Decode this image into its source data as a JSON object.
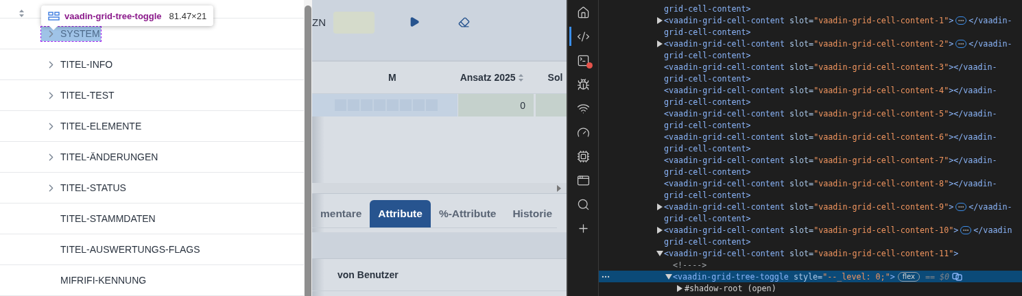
{
  "grid": {
    "rows": [
      {
        "name": "SYSTEM",
        "expandable": true,
        "highlighted": true
      },
      {
        "name": "TITEL-INFO",
        "expandable": true,
        "highlighted": false
      },
      {
        "name": "TITEL-TEST",
        "expandable": true,
        "highlighted": false
      },
      {
        "name": "TITEL-ELEMENTE",
        "expandable": true,
        "highlighted": false
      },
      {
        "name": "TITEL-ÄNDERUNGEN",
        "expandable": true,
        "highlighted": false
      },
      {
        "name": "TITEL-STATUS",
        "expandable": true,
        "highlighted": false
      },
      {
        "name": "TITEL-STAMMDATEN",
        "expandable": false,
        "highlighted": false
      },
      {
        "name": "TITEL-AUSWERTUNGS-FLAGS",
        "expandable": false,
        "highlighted": false
      },
      {
        "name": "MIFRIFI-KENNUNG",
        "expandable": false,
        "highlighted": false
      }
    ]
  },
  "inspector_tooltip": {
    "tag": "vaadin-grid-tree-toggle",
    "size": "81.47×21"
  },
  "app": {
    "filter_label": "ZN",
    "table": {
      "columns": [
        "M",
        "Ansatz 2025",
        "Sol"
      ],
      "row": [
        "0"
      ]
    },
    "tabs": [
      {
        "label": "mentare",
        "selected": false
      },
      {
        "label": "Attribute",
        "selected": true
      },
      {
        "label": "%-Attribute",
        "selected": false
      },
      {
        "label": "Historie",
        "selected": false
      }
    ],
    "detail": {
      "column": "von Benutzer"
    }
  },
  "devtools": {
    "activity": [
      {
        "selected": false,
        "alert": false
      },
      {
        "selected": true,
        "alert": false
      },
      {
        "selected": false,
        "alert": true
      },
      {
        "selected": false,
        "alert": false
      },
      {
        "selected": false,
        "alert": false
      },
      {
        "selected": false,
        "alert": false
      },
      {
        "selected": false,
        "alert": false
      },
      {
        "selected": false,
        "alert": false
      },
      {
        "selected": false,
        "alert": false
      },
      {
        "selected": false,
        "alert": false
      }
    ],
    "nodes": [
      {
        "kind": "tail",
        "selected": false,
        "text": "grid-cell-content>"
      },
      {
        "kind": "element",
        "has_children": true,
        "expanded": false,
        "selected": false,
        "tag": "<vaadin-grid-cell-content",
        "attr": " slot=",
        "value": "\"vaadin-grid-cell-content-1\"",
        "close": ">",
        "ellipsis": true,
        "end": "</vaadin-",
        "wrap": "grid-cell-content>"
      },
      {
        "kind": "element",
        "has_children": true,
        "expanded": false,
        "selected": false,
        "tag": "<vaadin-grid-cell-content",
        "attr": " slot=",
        "value": "\"vaadin-grid-cell-content-2\"",
        "close": ">",
        "ellipsis": true,
        "end": "</vaadin-",
        "wrap": "grid-cell-content>"
      },
      {
        "kind": "element",
        "has_children": false,
        "selected": false,
        "tag": "<vaadin-grid-cell-content",
        "attr": " slot=",
        "value": "\"vaadin-grid-cell-content-3\"",
        "close": ">",
        "ellipsis": false,
        "end": "</vaadin-",
        "wrap": "grid-cell-content>"
      },
      {
        "kind": "element",
        "has_children": false,
        "selected": false,
        "tag": "<vaadin-grid-cell-content",
        "attr": " slot=",
        "value": "\"vaadin-grid-cell-content-4\"",
        "close": ">",
        "ellipsis": false,
        "end": "</vaadin-",
        "wrap": "grid-cell-content>"
      },
      {
        "kind": "element",
        "has_children": false,
        "selected": false,
        "tag": "<vaadin-grid-cell-content",
        "attr": " slot=",
        "value": "\"vaadin-grid-cell-content-5\"",
        "close": ">",
        "ellipsis": false,
        "end": "</vaadin-",
        "wrap": "grid-cell-content>"
      },
      {
        "kind": "element",
        "has_children": false,
        "selected": false,
        "tag": "<vaadin-grid-cell-content",
        "attr": " slot=",
        "value": "\"vaadin-grid-cell-content-6\"",
        "close": ">",
        "ellipsis": false,
        "end": "</vaadin-",
        "wrap": "grid-cell-content>"
      },
      {
        "kind": "element",
        "has_children": false,
        "selected": false,
        "tag": "<vaadin-grid-cell-content",
        "attr": " slot=",
        "value": "\"vaadin-grid-cell-content-7\"",
        "close": ">",
        "ellipsis": false,
        "end": "</vaadin-",
        "wrap": "grid-cell-content>"
      },
      {
        "kind": "element",
        "has_children": false,
        "selected": false,
        "tag": "<vaadin-grid-cell-content",
        "attr": " slot=",
        "value": "\"vaadin-grid-cell-content-8\"",
        "close": ">",
        "ellipsis": false,
        "end": "</vaadin-",
        "wrap": "grid-cell-content>"
      },
      {
        "kind": "element",
        "has_children": true,
        "expanded": false,
        "selected": false,
        "tag": "<vaadin-grid-cell-content",
        "attr": " slot=",
        "value": "\"vaadin-grid-cell-content-9\"",
        "close": ">",
        "ellipsis": true,
        "end": "</vaadin-",
        "wrap": "grid-cell-content>"
      },
      {
        "kind": "element",
        "has_children": true,
        "expanded": false,
        "selected": false,
        "tag": "<vaadin-grid-cell-content",
        "attr": " slot=",
        "value": "\"vaadin-grid-cell-content-10\"",
        "close": ">",
        "ellipsis": true,
        "end": "</vaadin",
        "wrap": "grid-cell-content>"
      },
      {
        "kind": "element",
        "has_children": true,
        "expanded": true,
        "selected": false,
        "tag": "<vaadin-grid-cell-content",
        "attr": " slot=",
        "value": "\"vaadin-grid-cell-content-11\"",
        "close": ">",
        "ellipsis": false,
        "children": [
          {
            "kind": "comment",
            "selected": false,
            "text": "<!---->"
          },
          {
            "kind": "element",
            "has_children": true,
            "expanded": true,
            "selected": true,
            "tag": "<vaadin-grid-tree-toggle",
            "attr": " style=",
            "value": "\"--_level: 0;\"",
            "close": ">",
            "ellipsis": false,
            "badge": "flex",
            "ref": "== $0",
            "children": [
              {
                "kind": "shadow",
                "has_children": true,
                "expanded": false,
                "selected": false,
                "text": "#shadow-root (open)"
              }
            ]
          }
        ]
      }
    ]
  }
}
